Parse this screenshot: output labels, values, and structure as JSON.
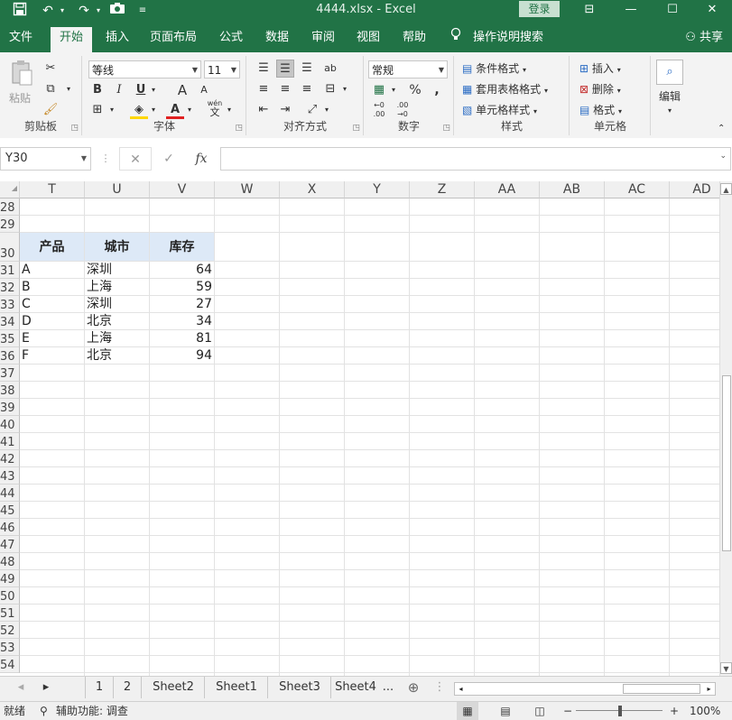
{
  "titlebar": {
    "document_title": "4444.xlsx  -  Excel",
    "login_label": "登录",
    "save_icon": "save-icon",
    "undo_icon": "undo-icon",
    "redo_icon": "redo-icon",
    "camera_icon": "camera-icon",
    "customize_icon": "customize-quick-access-icon"
  },
  "ribbon_tabs": [
    "文件",
    "开始",
    "插入",
    "页面布局",
    "公式",
    "数据",
    "审阅",
    "视图",
    "帮助",
    "操作说明搜索"
  ],
  "active_tab": "开始",
  "share_label": "共享",
  "ribbon": {
    "clipboard": {
      "label": "剪贴板",
      "paste": "粘贴"
    },
    "font": {
      "label": "字体",
      "font_name": "等线",
      "font_size": "11",
      "bold": "B",
      "italic": "I",
      "underline": "U",
      "grow": "A",
      "shrink": "A",
      "font_color": "A",
      "phonetic_top": "wén",
      "phonetic_bottom": "文"
    },
    "alignment": {
      "label": "对齐方式",
      "wrap": "ab"
    },
    "number": {
      "label": "数字",
      "format": "常规",
      "percent": "%",
      "comma": ","
    },
    "styles": {
      "label": "样式",
      "conditional": "条件格式",
      "table": "套用表格格式",
      "cell_styles": "单元格样式"
    },
    "cells": {
      "label": "单元格",
      "insert": "插入",
      "delete": "删除",
      "format": "格式"
    },
    "editing": {
      "label": "编辑"
    }
  },
  "formula_bar": {
    "name_box": "Y30",
    "cancel": "✕",
    "enter": "✓",
    "fx": "fx",
    "formula": ""
  },
  "columns": [
    "T",
    "U",
    "V",
    "W",
    "X",
    "Y",
    "Z",
    "AA",
    "AB",
    "AC",
    "AD"
  ],
  "rows": [
    "28",
    "29",
    "30",
    "31",
    "32",
    "33",
    "34",
    "35",
    "36",
    "37",
    "38",
    "39",
    "40",
    "41",
    "42",
    "43",
    "44",
    "45",
    "46",
    "47",
    "48",
    "49",
    "50",
    "51",
    "52",
    "53",
    "54"
  ],
  "table": {
    "headers": [
      "产品",
      "城市",
      "库存"
    ],
    "rows": [
      [
        "A",
        "深圳",
        "64"
      ],
      [
        "B",
        "上海",
        "59"
      ],
      [
        "C",
        "深圳",
        "27"
      ],
      [
        "D",
        "北京",
        "34"
      ],
      [
        "E",
        "上海",
        "81"
      ],
      [
        "F",
        "北京",
        "94"
      ]
    ]
  },
  "sheets": [
    "1",
    "2",
    "Sheet2",
    "Sheet1",
    "Sheet3",
    "Sheet4",
    "..."
  ],
  "status": {
    "ready": "就绪",
    "accessibility": "辅助功能: 调查",
    "zoom": "100%",
    "zoom_minus": "−",
    "zoom_plus": "+"
  },
  "colors": {
    "excel_green": "#217346",
    "header_fill": "#dde9f7"
  }
}
